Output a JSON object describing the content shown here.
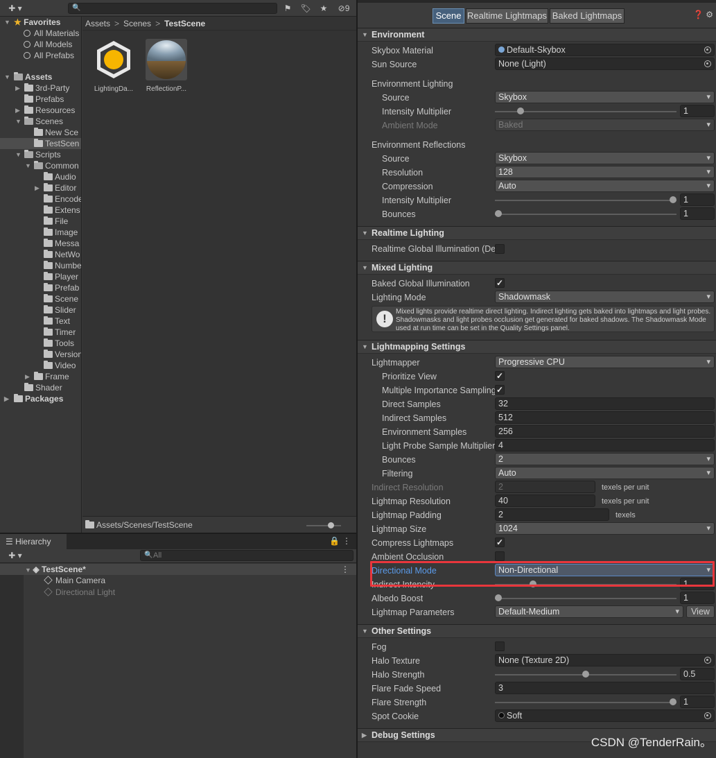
{
  "project": {
    "favorites": {
      "label": "Favorites",
      "items": [
        "All Materials",
        "All Models",
        "All Prefabs"
      ]
    },
    "assets_root": "Assets",
    "tree": [
      {
        "label": "3rd-Party"
      },
      {
        "label": "Prefabs"
      },
      {
        "label": "Resources"
      },
      {
        "label": "Scenes"
      },
      {
        "label": "New Sce"
      },
      {
        "label": "TestScen"
      },
      {
        "label": "Scripts"
      },
      {
        "label": "Common"
      },
      {
        "label": "Audio"
      },
      {
        "label": "Editor"
      },
      {
        "label": "Encode"
      },
      {
        "label": "Extens"
      },
      {
        "label": "File"
      },
      {
        "label": "Image"
      },
      {
        "label": "Messa"
      },
      {
        "label": "NetWo"
      },
      {
        "label": "Numbe"
      },
      {
        "label": "Player"
      },
      {
        "label": "Prefab"
      },
      {
        "label": "Scene"
      },
      {
        "label": "Slider"
      },
      {
        "label": "Text"
      },
      {
        "label": "Timer"
      },
      {
        "label": "Tools"
      },
      {
        "label": "Version"
      },
      {
        "label": "Video"
      },
      {
        "label": "Frame"
      },
      {
        "label": "Shader"
      }
    ],
    "packages": "Packages",
    "breadcrumb": [
      "Assets",
      "Scenes",
      "TestScene"
    ],
    "assets": [
      {
        "label": "LightingDa..."
      },
      {
        "label": "ReflectionP..."
      }
    ],
    "status_path": "Assets/Scenes/TestScene",
    "hidden_count": "9"
  },
  "hierarchy": {
    "tab": "Hierarchy",
    "search_placeholder": "All",
    "scene": "TestScene*",
    "objects": [
      "Main Camera",
      "Directional Light"
    ]
  },
  "lighting": {
    "tabs": [
      "Scene",
      "Realtime Lightmaps",
      "Baked Lightmaps"
    ],
    "environment": {
      "header": "Environment",
      "skybox_label": "Skybox Material",
      "skybox_value": "Default-Skybox",
      "sun_label": "Sun Source",
      "sun_value": "None (Light)",
      "env_lighting_label": "Environment Lighting",
      "source_label": "Source",
      "source_value": "Skybox",
      "intensity_label": "Intensity Multiplier",
      "intensity_value": "1",
      "ambient_label": "Ambient Mode",
      "ambient_value": "Baked",
      "env_reflections_label": "Environment Reflections",
      "refl_source_label": "Source",
      "refl_source_value": "Skybox",
      "resolution_label": "Resolution",
      "resolution_value": "128",
      "compression_label": "Compression",
      "compression_value": "Auto",
      "refl_intensity_label": "Intensity Multiplier",
      "refl_intensity_value": "1",
      "bounces_label": "Bounces",
      "bounces_value": "1"
    },
    "realtime": {
      "header": "Realtime Lighting",
      "rt_gi_label": "Realtime Global Illumination (De"
    },
    "mixed": {
      "header": "Mixed Lighting",
      "baked_gi_label": "Baked Global Illumination",
      "mode_label": "Lighting Mode",
      "mode_value": "Shadowmask",
      "help": "Mixed lights provide realtime direct lighting. Indirect lighting gets baked into lightmaps and light probes. Shadowmasks and light probes occlusion get generated for baked shadows. The Shadowmask Mode used at run time can be set in the Quality Settings panel."
    },
    "lightmapping": {
      "header": "Lightmapping Settings",
      "lightmapper_label": "Lightmapper",
      "lightmapper_value": "Progressive CPU",
      "prioritize_label": "Prioritize View",
      "mis_label": "Multiple Importance Sampling",
      "direct_label": "Direct Samples",
      "direct_value": "32",
      "indirect_label": "Indirect Samples",
      "indirect_value": "512",
      "envsamples_label": "Environment Samples",
      "envsamples_value": "256",
      "probe_mult_label": "Light Probe Sample Multiplier",
      "probe_mult_value": "4",
      "bounces_label": "Bounces",
      "bounces_value": "2",
      "filtering_label": "Filtering",
      "filtering_value": "Auto",
      "indirect_res_label": "Indirect Resolution",
      "indirect_res_value": "2",
      "indirect_res_unit": "texels per unit",
      "lm_res_label": "Lightmap Resolution",
      "lm_res_value": "40",
      "lm_res_unit": "texels per unit",
      "padding_label": "Lightmap Padding",
      "padding_value": "2",
      "padding_unit": "texels",
      "size_label": "Lightmap Size",
      "size_value": "1024",
      "compress_label": "Compress Lightmaps",
      "ao_label": "Ambient Occlusion",
      "dir_mode_label": "Directional Mode",
      "dir_mode_value": "Non-Directional",
      "indirect_int_label": "Indirect Intencity",
      "indirect_int_value": "1",
      "albedo_label": "Albedo Boost",
      "albedo_value": "1",
      "params_label": "Lightmap Parameters",
      "params_value": "Default-Medium",
      "view_label": "View"
    },
    "other": {
      "header": "Other Settings",
      "fog_label": "Fog",
      "halo_tex_label": "Halo Texture",
      "halo_tex_value": "None (Texture 2D)",
      "halo_str_label": "Halo Strength",
      "halo_str_value": "0.5",
      "flare_fade_label": "Flare Fade Speed",
      "flare_fade_value": "3",
      "flare_str_label": "Flare Strength",
      "flare_str_value": "1",
      "cookie_label": "Spot Cookie",
      "cookie_value": "Soft"
    },
    "debug": {
      "header": "Debug Settings"
    }
  },
  "watermark": "CSDN @TenderRain。",
  "colors": {
    "highlight": "#e8363c",
    "active_tab": "#46607c",
    "link_label": "#5b9bea"
  }
}
